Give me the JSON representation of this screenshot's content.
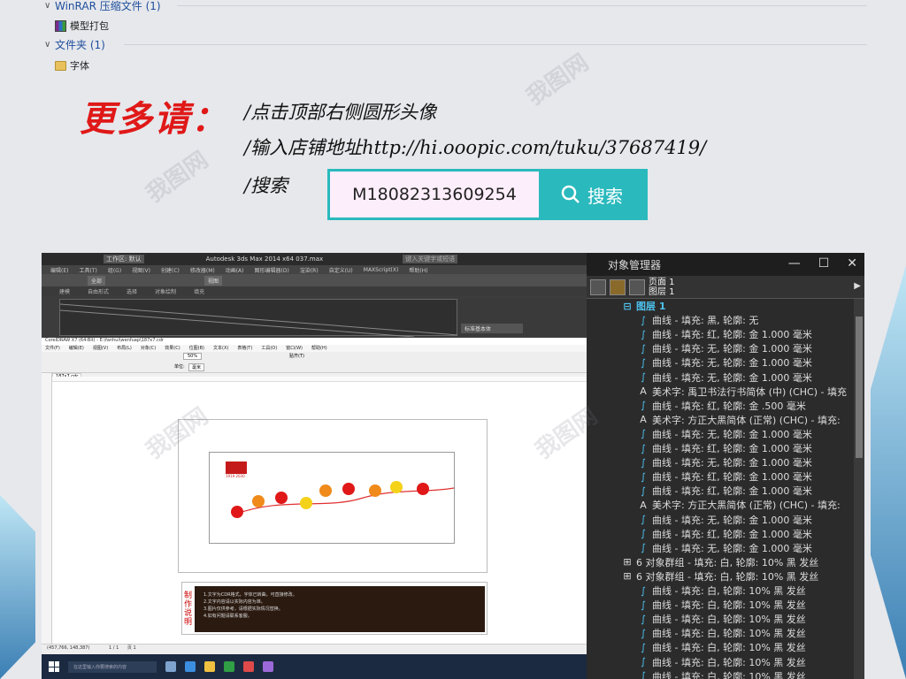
{
  "explorer": {
    "group1_label": "WinRAR 压缩文件 (1)",
    "group1_item": "模型打包",
    "group2_label": "文件夹 (1)",
    "group2_item": "字体"
  },
  "promo": {
    "heading": "更多请：",
    "line1": "/点击顶部右侧圆形头像",
    "line2": "/输入店铺地址http://hi.ooopic.com/tuku/37687419/",
    "line3": "/搜索",
    "search_value": "M18082313609254",
    "search_button": "搜索"
  },
  "max_window": {
    "title": "Autodesk 3ds Max  2014 x64     037.max",
    "workspace": "工作区: 默认",
    "search_placeholder": "键入关键字或短语",
    "menu": [
      "编辑(E)",
      "工具(T)",
      "组(G)",
      "视图(V)",
      "创建(C)",
      "修改器(M)",
      "动画(A)",
      "图形编辑器(D)",
      "渲染(R)",
      "自定义(U)",
      "MAXScript(X)",
      "帮助(H)"
    ],
    "tabs": [
      "建模",
      "自由形式",
      "选择",
      "对象绘制",
      "填充"
    ],
    "dropdown_all": "全部",
    "dropdown_view": "视图",
    "panel_label": "标准基本体"
  },
  "corel_window": {
    "title": "CorelDRAW X7 (64-Bit) - E:\\fanhui\\wenfuap\\187x7.cdr",
    "menu": [
      "文件(F)",
      "编辑(E)",
      "视图(V)",
      "布局(L)",
      "对象(C)",
      "效果(C)",
      "位图(B)",
      "文本(X)",
      "表格(T)",
      "工具(O)",
      "窗口(W)",
      "帮助(H)"
    ],
    "zoom": "50%",
    "units_label": "单位:",
    "units": "毫米",
    "snap_label": "贴齐(T)",
    "doc_tab": "187x7.cdr",
    "page_nav": "1 / 1",
    "page_tab": "页 1",
    "status": "(457,766, 148,387)",
    "note_title": "制作说明",
    "note_lines": [
      "1.文字为CDR格式，字体已转曲，可直接修改。",
      "2.文字内容请以实际内容为准。",
      "3.图片仅供参考，请根据实际情况替换。",
      "4.如有问题请联系客服。"
    ],
    "card_logo_text": "1919 2030"
  },
  "taskbar": {
    "search_placeholder": "在这里输入你要搜索的内容"
  },
  "object_manager": {
    "title": "对象管理器",
    "page_label": "页面 1",
    "layer_label": "图层 1",
    "header_text": "页面:\n图层 1",
    "controls": [
      "—",
      "☐",
      "✕"
    ],
    "rows": [
      {
        "type": "layer",
        "text": "图层 1"
      },
      {
        "type": "curve",
        "text": "曲线 - 填充: 黑, 轮廓: 无"
      },
      {
        "type": "curve",
        "text": "曲线 - 填充: 红, 轮廓: 金  1.000 毫米"
      },
      {
        "type": "curve",
        "text": "曲线 - 填充: 无, 轮廓: 金  1.000 毫米"
      },
      {
        "type": "curve",
        "text": "曲线 - 填充: 无, 轮廓: 金  1.000 毫米"
      },
      {
        "type": "curve",
        "text": "曲线 - 填充: 无, 轮廓: 金  1.000 毫米"
      },
      {
        "type": "text",
        "text": "美术字: 禹卫书法行书简体 (中) (CHC) - 填充"
      },
      {
        "type": "curve",
        "text": "曲线 - 填充: 红, 轮廓: 金  .500 毫米"
      },
      {
        "type": "text",
        "text": "美术字: 方正大黑简体 (正常) (CHC) - 填充:"
      },
      {
        "type": "curve",
        "text": "曲线 - 填充: 无, 轮廓: 金  1.000 毫米"
      },
      {
        "type": "curve",
        "text": "曲线 - 填充: 红, 轮廓: 金  1.000 毫米"
      },
      {
        "type": "curve",
        "text": "曲线 - 填充: 无, 轮廓: 金  1.000 毫米"
      },
      {
        "type": "curve",
        "text": "曲线 - 填充: 红, 轮廓: 金  1.000 毫米"
      },
      {
        "type": "curve",
        "text": "曲线 - 填充: 红, 轮廓: 金  1.000 毫米"
      },
      {
        "type": "text",
        "text": "美术字: 方正大黑简体 (正常) (CHC) - 填充:"
      },
      {
        "type": "curve",
        "text": "曲线 - 填充: 无, 轮廓: 金  1.000 毫米"
      },
      {
        "type": "curve",
        "text": "曲线 - 填充: 红, 轮廓: 金  1.000 毫米"
      },
      {
        "type": "curve",
        "text": "曲线 - 填充: 无, 轮廓: 金  1.000 毫米"
      },
      {
        "type": "group",
        "text": "6 对象群组 - 填充: 白, 轮廓: 10% 黑 发丝"
      },
      {
        "type": "group",
        "text": "6 对象群组 - 填充: 白, 轮廓: 10% 黑 发丝"
      },
      {
        "type": "curve",
        "text": "曲线 - 填充: 白, 轮廓: 10% 黑 发丝"
      },
      {
        "type": "curve",
        "text": "曲线 - 填充: 白, 轮廓: 10% 黑 发丝"
      },
      {
        "type": "curve",
        "text": "曲线 - 填充: 白, 轮廓: 10% 黑 发丝"
      },
      {
        "type": "curve",
        "text": "曲线 - 填充: 白, 轮廓: 10% 黑 发丝"
      },
      {
        "type": "curve",
        "text": "曲线 - 填充: 白, 轮廓: 10% 黑 发丝"
      },
      {
        "type": "curve",
        "text": "曲线 - 填充: 白, 轮廓: 10% 黑 发丝"
      },
      {
        "type": "curve",
        "text": "曲线 - 填充: 白, 轮廓: 10% 黑 发丝"
      },
      {
        "type": "curve",
        "text": "曲线 - 填充: 白, 轮廓: 10% 黑 发丝"
      }
    ]
  },
  "watermark": "我图网",
  "colors": {
    "accent": "#2ab9bd",
    "promo_red": "#e01818",
    "layer_blue": "#4ec3f0"
  }
}
